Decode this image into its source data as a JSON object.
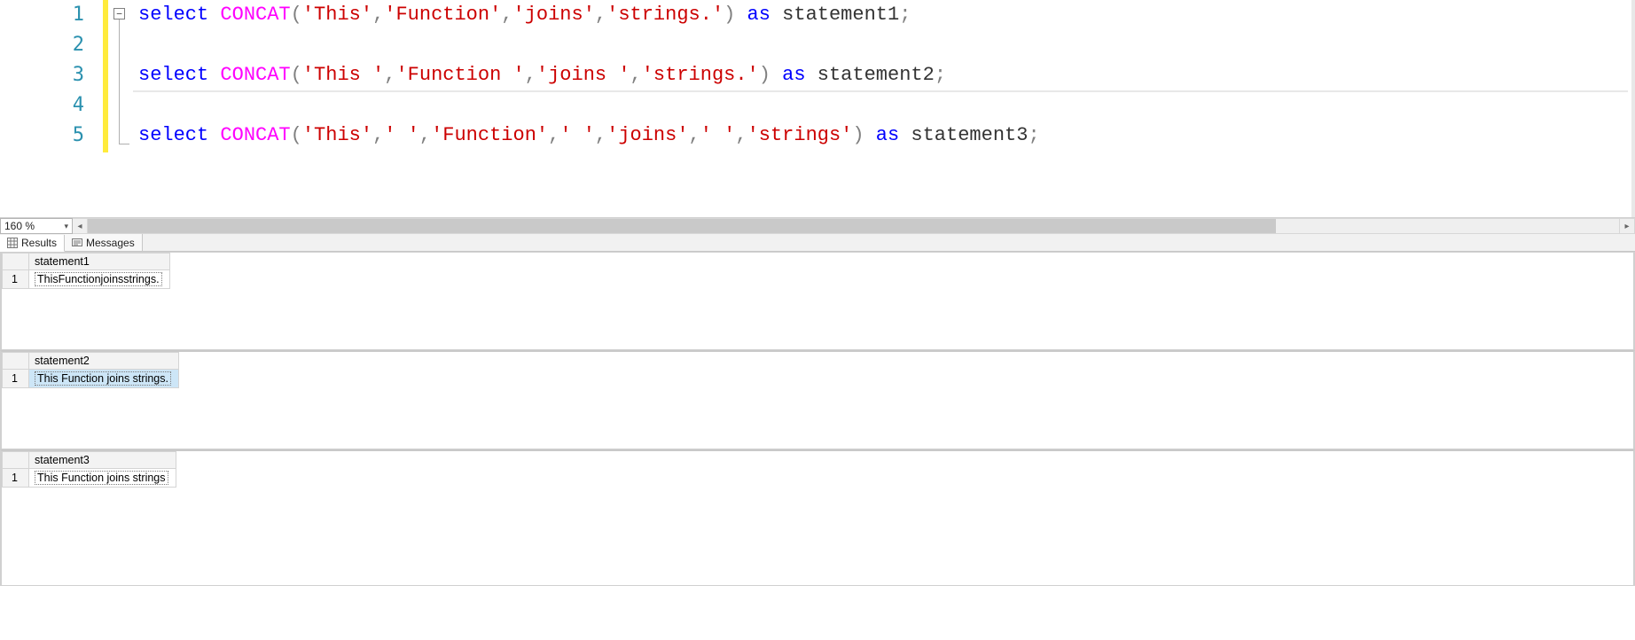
{
  "editor": {
    "zoom_level": "160 %",
    "highlight_color": "#ffeb3b",
    "lines": [
      {
        "n": 1,
        "tokens": [
          {
            "t": "select ",
            "c": "kw"
          },
          {
            "t": "CONCAT",
            "c": "fn"
          },
          {
            "t": "(",
            "c": "gr"
          },
          {
            "t": "'This'",
            "c": "str"
          },
          {
            "t": ",",
            "c": "gr"
          },
          {
            "t": "'Function'",
            "c": "str"
          },
          {
            "t": ",",
            "c": "gr"
          },
          {
            "t": "'joins'",
            "c": "str"
          },
          {
            "t": ",",
            "c": "gr"
          },
          {
            "t": "'strings.'",
            "c": "str"
          },
          {
            "t": ")",
            "c": "gr"
          },
          {
            "t": " as ",
            "c": "kw"
          },
          {
            "t": "statement1",
            "c": "pl"
          },
          {
            "t": ";",
            "c": "gr"
          }
        ]
      },
      {
        "n": 2,
        "tokens": []
      },
      {
        "n": 3,
        "tokens": [
          {
            "t": "select ",
            "c": "kw"
          },
          {
            "t": "CONCAT",
            "c": "fn"
          },
          {
            "t": "(",
            "c": "gr"
          },
          {
            "t": "'This '",
            "c": "str"
          },
          {
            "t": ",",
            "c": "gr"
          },
          {
            "t": "'Function '",
            "c": "str"
          },
          {
            "t": ",",
            "c": "gr"
          },
          {
            "t": "'joins '",
            "c": "str"
          },
          {
            "t": ",",
            "c": "gr"
          },
          {
            "t": "'strings.'",
            "c": "str"
          },
          {
            "t": ")",
            "c": "gr"
          },
          {
            "t": " as ",
            "c": "kw"
          },
          {
            "t": "statement2",
            "c": "pl"
          },
          {
            "t": ";",
            "c": "gr"
          }
        ]
      },
      {
        "n": 4,
        "tokens": []
      },
      {
        "n": 5,
        "tokens": [
          {
            "t": "select ",
            "c": "kw"
          },
          {
            "t": "CONCAT",
            "c": "fn"
          },
          {
            "t": "(",
            "c": "gr"
          },
          {
            "t": "'This'",
            "c": "str"
          },
          {
            "t": ",",
            "c": "gr"
          },
          {
            "t": "' '",
            "c": "str"
          },
          {
            "t": ",",
            "c": "gr"
          },
          {
            "t": "'Function'",
            "c": "str"
          },
          {
            "t": ",",
            "c": "gr"
          },
          {
            "t": "' '",
            "c": "str"
          },
          {
            "t": ",",
            "c": "gr"
          },
          {
            "t": "'joins'",
            "c": "str"
          },
          {
            "t": ",",
            "c": "gr"
          },
          {
            "t": "' '",
            "c": "str"
          },
          {
            "t": ",",
            "c": "gr"
          },
          {
            "t": "'strings'",
            "c": "str"
          },
          {
            "t": ")",
            "c": "gr"
          },
          {
            "t": " as ",
            "c": "kw"
          },
          {
            "t": "statement3",
            "c": "pl"
          },
          {
            "t": ";",
            "c": "gr"
          }
        ]
      }
    ],
    "current_line": 4
  },
  "tabs": {
    "results_label": "Results",
    "messages_label": "Messages"
  },
  "results": {
    "panes": [
      {
        "column": "statement1",
        "row_num": "1",
        "value": "ThisFunctionjoinsstrings.",
        "selected": false
      },
      {
        "column": "statement2",
        "row_num": "1",
        "value": "This Function joins strings.",
        "selected": true
      },
      {
        "column": "statement3",
        "row_num": "1",
        "value": "This Function joins strings",
        "selected": false
      }
    ]
  }
}
